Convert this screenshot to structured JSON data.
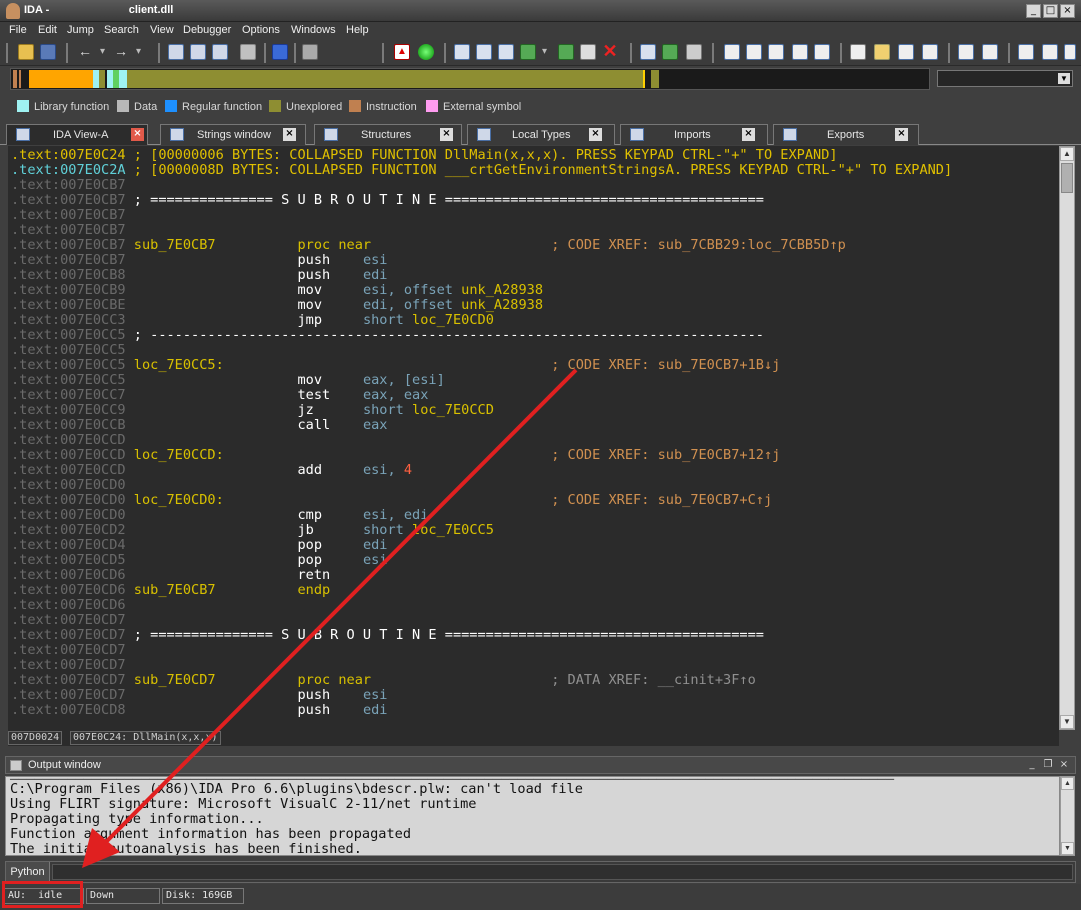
{
  "window": {
    "title_prefix": "IDA - ",
    "title_file": "client.dll",
    "min_glyph": "_",
    "max_glyph": "□",
    "close_glyph": "×"
  },
  "menu": [
    "File",
    "Edit",
    "Jump",
    "Search",
    "View",
    "Debugger",
    "Options",
    "Windows",
    "Help"
  ],
  "segment_dropdown": {
    "value": "",
    "arrow": "▼"
  },
  "legend": [
    {
      "label": "Library function",
      "color": "#9ff2f2"
    },
    {
      "label": "Data",
      "color": "#b8b8b8"
    },
    {
      "label": "Regular function",
      "color": "#1e90ff"
    },
    {
      "label": "Unexplored",
      "color": "#8e8e32"
    },
    {
      "label": "Instruction",
      "color": "#c08050"
    },
    {
      "label": "External symbol",
      "color": "#ff9cf0"
    }
  ],
  "tabs": [
    {
      "label": "IDA View-A",
      "active": true,
      "close": "×"
    },
    {
      "label": "Strings window",
      "active": false,
      "close": "×"
    },
    {
      "label": "Structures",
      "active": false,
      "close": "×"
    },
    {
      "label": "Local Types",
      "active": false,
      "close": "×"
    },
    {
      "label": "Imports",
      "active": false,
      "close": "×"
    },
    {
      "label": "Exports",
      "active": false,
      "close": "×"
    }
  ],
  "disasm": {
    "collapsed": [
      {
        "addr": ".text:007E0C24",
        "text": " ; [00000006 BYTES: COLLAPSED FUNCTION DllMain(x,x,x). PRESS KEYPAD CTRL-\"+\" TO EXPAND]"
      },
      {
        "addr": ".text:007E0C2A",
        "text": " ; [0000008D BYTES: COLLAPSED FUNCTION ___crtGetEnvironmentStringsA. PRESS KEYPAD CTRL-\"+\" TO EXPAND]"
      }
    ],
    "lines": [
      {
        "addr": ".text:007E0CB7",
        "label": "",
        "mnem": "",
        "ops": [],
        "comment": ""
      },
      {
        "addr": ".text:007E0CB7",
        "sep": " ; =============== S U B R O U T I N E ======================================="
      },
      {
        "addr": ".text:007E0CB7",
        "label": "",
        "mnem": "",
        "ops": [],
        "comment": ""
      },
      {
        "addr": ".text:007E0CB7",
        "label": "",
        "mnem": "",
        "ops": [],
        "comment": ""
      },
      {
        "addr": ".text:007E0CB7",
        "label": "sub_7E0CB7",
        "mnem": "proc near",
        "mnemclass": "kw",
        "ops": [],
        "comment": "; CODE XREF: sub_7CBB29:loc_7CBB5D↑p",
        "ccls": "xr"
      },
      {
        "addr": ".text:007E0CB7",
        "label": "",
        "mnem": "push",
        "ops": [
          {
            "t": "esi",
            "c": "reg"
          }
        ],
        "comment": ""
      },
      {
        "addr": ".text:007E0CB8",
        "label": "",
        "mnem": "push",
        "ops": [
          {
            "t": "edi",
            "c": "reg"
          }
        ],
        "comment": ""
      },
      {
        "addr": ".text:007E0CB9",
        "label": "",
        "mnem": "mov",
        "ops": [
          {
            "t": "esi, offset ",
            "c": "reg"
          },
          {
            "t": "unk_A28938",
            "c": "sym"
          }
        ],
        "comment": ""
      },
      {
        "addr": ".text:007E0CBE",
        "label": "",
        "mnem": "mov",
        "ops": [
          {
            "t": "edi, offset ",
            "c": "reg"
          },
          {
            "t": "unk_A28938",
            "c": "sym"
          }
        ],
        "comment": ""
      },
      {
        "addr": ".text:007E0CC3",
        "label": "",
        "mnem": "jmp",
        "ops": [
          {
            "t": "short ",
            "c": "reg"
          },
          {
            "t": "loc_7E0CD0",
            "c": "sym"
          }
        ],
        "comment": ""
      },
      {
        "addr": ".text:007E0CC5",
        "sep": " ; ---------------------------------------------------------------------------"
      },
      {
        "addr": ".text:007E0CC5",
        "label": "",
        "mnem": "",
        "ops": [],
        "comment": ""
      },
      {
        "addr": ".text:007E0CC5",
        "label": "loc_7E0CC5:",
        "mnem": "",
        "ops": [],
        "comment": "; CODE XREF: sub_7E0CB7+1B↓j",
        "ccls": "xr"
      },
      {
        "addr": ".text:007E0CC5",
        "label": "",
        "mnem": "mov",
        "ops": [
          {
            "t": "eax, [esi]",
            "c": "reg"
          }
        ],
        "comment": ""
      },
      {
        "addr": ".text:007E0CC7",
        "label": "",
        "mnem": "test",
        "ops": [
          {
            "t": "eax, eax",
            "c": "reg"
          }
        ],
        "comment": ""
      },
      {
        "addr": ".text:007E0CC9",
        "label": "",
        "mnem": "jz",
        "ops": [
          {
            "t": "short ",
            "c": "reg"
          },
          {
            "t": "loc_7E0CCD",
            "c": "sym"
          }
        ],
        "comment": ""
      },
      {
        "addr": ".text:007E0CCB",
        "label": "",
        "mnem": "call",
        "ops": [
          {
            "t": "eax",
            "c": "reg"
          }
        ],
        "comment": ""
      },
      {
        "addr": ".text:007E0CCD",
        "label": "",
        "mnem": "",
        "ops": [],
        "comment": ""
      },
      {
        "addr": ".text:007E0CCD",
        "label": "loc_7E0CCD:",
        "mnem": "",
        "ops": [],
        "comment": "; CODE XREF: sub_7E0CB7+12↑j",
        "ccls": "xr"
      },
      {
        "addr": ".text:007E0CCD",
        "label": "",
        "mnem": "add",
        "ops": [
          {
            "t": "esi, ",
            "c": "reg"
          },
          {
            "t": "4",
            "c": "num"
          }
        ],
        "comment": ""
      },
      {
        "addr": ".text:007E0CD0",
        "label": "",
        "mnem": "",
        "ops": [],
        "comment": ""
      },
      {
        "addr": ".text:007E0CD0",
        "label": "loc_7E0CD0:",
        "mnem": "",
        "ops": [],
        "comment": "; CODE XREF: sub_7E0CB7+C↑j",
        "ccls": "xr"
      },
      {
        "addr": ".text:007E0CD0",
        "label": "",
        "mnem": "cmp",
        "ops": [
          {
            "t": "esi, edi",
            "c": "reg"
          }
        ],
        "comment": ""
      },
      {
        "addr": ".text:007E0CD2",
        "label": "",
        "mnem": "jb",
        "ops": [
          {
            "t": "short ",
            "c": "reg"
          },
          {
            "t": "loc_7E0CC5",
            "c": "sym"
          }
        ],
        "comment": ""
      },
      {
        "addr": ".text:007E0CD4",
        "label": "",
        "mnem": "pop",
        "ops": [
          {
            "t": "edi",
            "c": "reg"
          }
        ],
        "comment": ""
      },
      {
        "addr": ".text:007E0CD5",
        "label": "",
        "mnem": "pop",
        "ops": [
          {
            "t": "esi",
            "c": "reg"
          }
        ],
        "comment": ""
      },
      {
        "addr": ".text:007E0CD6",
        "label": "",
        "mnem": "retn",
        "ops": [],
        "comment": ""
      },
      {
        "addr": ".text:007E0CD6",
        "label": "sub_7E0CB7",
        "mnem": "endp",
        "mnemclass": "kw",
        "ops": [],
        "comment": ""
      },
      {
        "addr": ".text:007E0CD6",
        "label": "",
        "mnem": "",
        "ops": [],
        "comment": ""
      },
      {
        "addr": ".text:007E0CD7",
        "label": "",
        "mnem": "",
        "ops": [],
        "comment": ""
      },
      {
        "addr": ".text:007E0CD7",
        "sep": " ; =============== S U B R O U T I N E ======================================="
      },
      {
        "addr": ".text:007E0CD7",
        "label": "",
        "mnem": "",
        "ops": [],
        "comment": ""
      },
      {
        "addr": ".text:007E0CD7",
        "label": "",
        "mnem": "",
        "ops": [],
        "comment": ""
      },
      {
        "addr": ".text:007E0CD7",
        "label": "sub_7E0CD7",
        "mnem": "proc near",
        "mnemclass": "kw",
        "ops": [],
        "comment": "; DATA XREF: __cinit+3F↑o",
        "ccls": "cmt"
      },
      {
        "addr": ".text:007E0CD7",
        "label": "",
        "mnem": "push",
        "ops": [
          {
            "t": "esi",
            "c": "reg"
          }
        ],
        "comment": ""
      },
      {
        "addr": ".text:007E0CD8",
        "label": "",
        "mnem": "push",
        "ops": [
          {
            "t": "edi",
            "c": "reg"
          }
        ],
        "comment": ""
      }
    ]
  },
  "location_bar": {
    "offset": "007D0024",
    "location": "007E0C24: DllMain(x,x,x)"
  },
  "output": {
    "title": "Output window",
    "lines": [
      "C:\\Program Files (x86)\\IDA Pro 6.6\\plugins\\bdescr.plw: can't load file",
      "Using FLIRT signature: Microsoft VisualC 2-11/net runtime",
      "Propagating type information...",
      "Function argument information has been propagated",
      "The initial autoanalysis has been finished."
    ]
  },
  "command": {
    "button": "Python",
    "value": ""
  },
  "status": {
    "au": "AU:  idle",
    "direction": "Down",
    "disk": "Disk: 169GB"
  }
}
